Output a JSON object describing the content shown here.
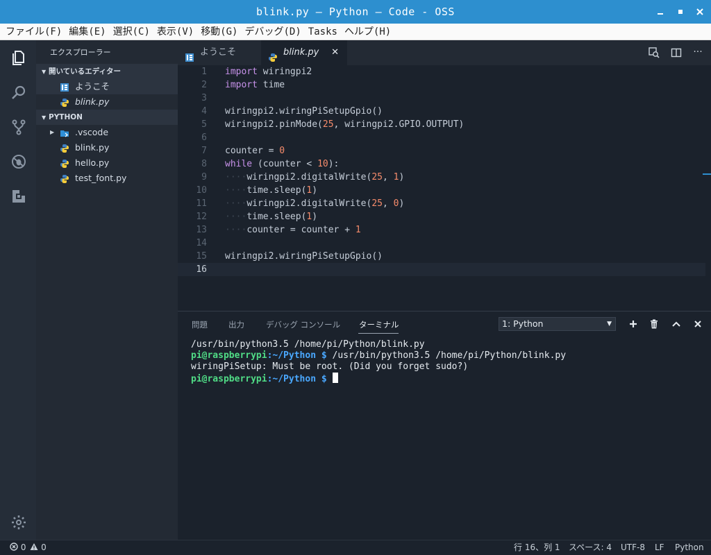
{
  "window": {
    "title": "blink.py — Python — Code - OSS"
  },
  "menu": [
    "ファイル(F)",
    "編集(E)",
    "選択(C)",
    "表示(V)",
    "移動(G)",
    "デバッグ(D)",
    "Tasks",
    "ヘルプ(H)"
  ],
  "sidebar": {
    "title": "エクスプローラー",
    "open_editors": {
      "label": "開いているエディター",
      "items": [
        {
          "label": "ようこそ",
          "icon": "welcome-icon"
        },
        {
          "label": "blink.py",
          "icon": "python-file-icon"
        }
      ]
    },
    "folder": {
      "label": "PYTHON",
      "items": [
        {
          "label": ".vscode",
          "icon": "vscode-folder-icon"
        },
        {
          "label": "blink.py",
          "icon": "python-file-icon"
        },
        {
          "label": "hello.py",
          "icon": "python-file-icon"
        },
        {
          "label": "test_font.py",
          "icon": "python-file-icon"
        }
      ]
    }
  },
  "tabs": [
    {
      "label": "ようこそ",
      "active": false
    },
    {
      "label": "blink.py",
      "active": true
    }
  ],
  "editor": {
    "lines": [
      "import wiringpi2",
      "import time",
      "",
      "wiringpi2.wiringPiSetupGpio()",
      "wiringpi2.pinMode(25, wiringpi2.GPIO.OUTPUT)",
      "",
      "counter = 0",
      "while (counter < 10):",
      "    wiringpi2.digitalWrite(25, 1)",
      "    time.sleep(1)",
      "    wiringpi2.digitalWrite(25, 0)",
      "    time.sleep(1)",
      "    counter = counter + 1",
      "",
      "wiringpi2.wiringPiSetupGpio()",
      ""
    ],
    "current_line": 16
  },
  "panel": {
    "tabs": [
      "問題",
      "出力",
      "デバッグ コンソール",
      "ターミナル"
    ],
    "active_tab": "ターミナル",
    "terminal_select": "1: Python",
    "terminal": {
      "line1": "/usr/bin/python3.5 /home/pi/Python/blink.py",
      "prompt_user": "pi@raspberrypi",
      "prompt_path": ":~/Python $",
      "cmd2": " /usr/bin/python3.5 /home/pi/Python/blink.py",
      "line3": "wiringPiSetup: Must be root. (Did you forget sudo?)"
    }
  },
  "status": {
    "errors": "0",
    "warnings": "0",
    "position": "行 16、列 1",
    "spaces": "スペース: 4",
    "encoding": "UTF-8",
    "eol": "LF",
    "language": "Python"
  },
  "colors": {
    "accent": "#2d8fcf",
    "sidebar": "#232a34",
    "editor": "#1b222c",
    "activity": "#252d38"
  }
}
